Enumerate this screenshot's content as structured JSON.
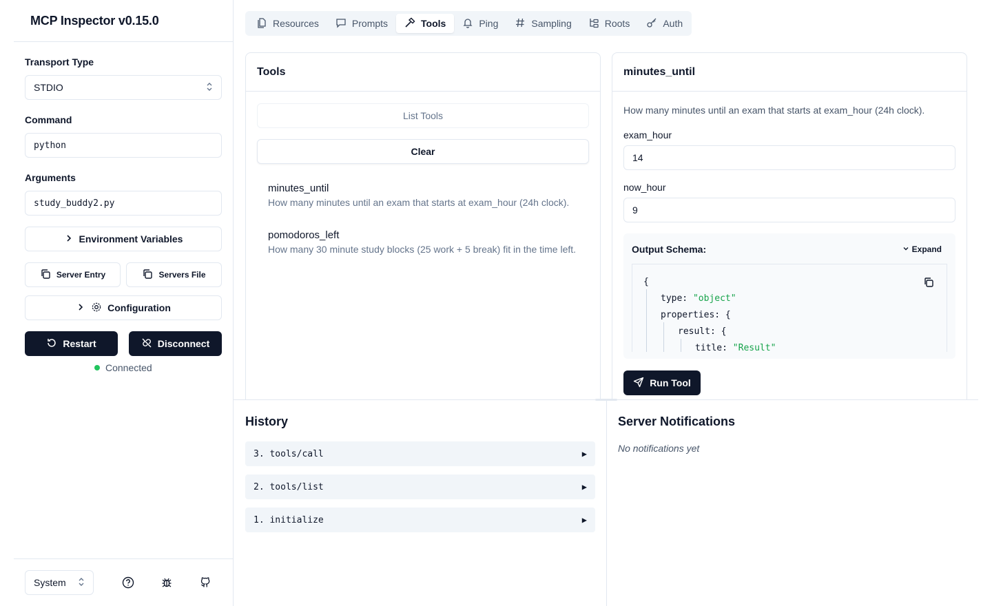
{
  "app": {
    "title": "MCP Inspector v0.15.0"
  },
  "sidebar": {
    "transport_label": "Transport Type",
    "transport_value": "STDIO",
    "command_label": "Command",
    "command_value": "python",
    "arguments_label": "Arguments",
    "arguments_value": "study_buddy2.py",
    "env_button": "Environment Variables",
    "server_entry_button": "Server Entry",
    "servers_file_button": "Servers File",
    "config_button": "Configuration",
    "restart_button": "Restart",
    "disconnect_button": "Disconnect",
    "status_text": "Connected",
    "status_color": "#22c55e",
    "theme_value": "System"
  },
  "tabs": [
    {
      "label": "Resources",
      "icon": "files-icon"
    },
    {
      "label": "Prompts",
      "icon": "message-square-icon"
    },
    {
      "label": "Tools",
      "icon": "hammer-icon",
      "active": true
    },
    {
      "label": "Ping",
      "icon": "bell-icon"
    },
    {
      "label": "Sampling",
      "icon": "hash-icon"
    },
    {
      "label": "Roots",
      "icon": "folder-tree-icon"
    },
    {
      "label": "Auth",
      "icon": "key-icon"
    }
  ],
  "tools_panel": {
    "title": "Tools",
    "list_button": "List Tools",
    "clear_button": "Clear",
    "items": [
      {
        "name": "minutes_until",
        "description": "How many minutes until an exam that starts at exam_hour (24h clock)."
      },
      {
        "name": "pomodoros_left",
        "description": "How many 30 minute study blocks (25 work + 5 break) fit in the time left."
      }
    ]
  },
  "detail_panel": {
    "title": "minutes_until",
    "description": "How many minutes until an exam that starts at exam_hour (24h clock).",
    "params": [
      {
        "label": "exam_hour",
        "value": "14"
      },
      {
        "label": "now_hour",
        "value": "9"
      }
    ],
    "schema_label": "Output Schema:",
    "expand_label": "Expand",
    "schema_lines": {
      "open": "{",
      "type_key": "type:",
      "type_val": "\"object\"",
      "props_key": "properties:",
      "props_open": "{",
      "result_key": "result:",
      "result_open": "{",
      "title_key": "title:",
      "title_val": "\"Result\""
    },
    "run_button": "Run Tool"
  },
  "history": {
    "title": "History",
    "items": [
      "3. tools/call",
      "2. tools/list",
      "1. initialize"
    ]
  },
  "notifications": {
    "title": "Server Notifications",
    "empty_text": "No notifications yet"
  }
}
